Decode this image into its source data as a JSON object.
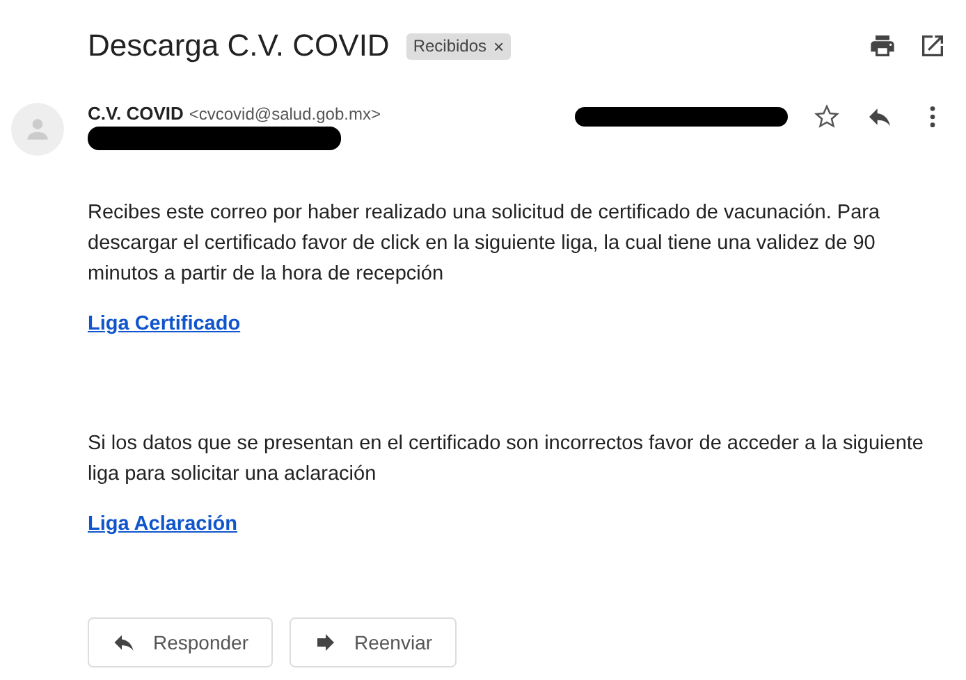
{
  "subject": "Descarga C.V. COVID",
  "label": {
    "text": "Recibidos",
    "close": "×"
  },
  "sender": {
    "name": "C.V. COVID",
    "email": "<cvcovid@salud.gob.mx>",
    "starred": false
  },
  "body": [
    {
      "kind": "paragraph",
      "text": "Recibes este correo por haber realizado una solicitud de certificado de vacunación. Para descargar el certificado favor de click en la siguiente liga, la cual tiene una validez de 90 minutos a partir de la hora de recepción"
    },
    {
      "kind": "link",
      "text": "Liga Certificado"
    },
    {
      "kind": "spacer"
    },
    {
      "kind": "paragraph",
      "text": "Si los datos que se presentan en el certificado son incorrectos favor de acceder a la siguiente liga para solicitar una aclaración"
    },
    {
      "kind": "link",
      "text": "Liga Aclaración"
    }
  ],
  "buttons": [
    {
      "kind": "reply",
      "label": "Responder"
    },
    {
      "kind": "forward",
      "label": "Reenviar"
    }
  ]
}
